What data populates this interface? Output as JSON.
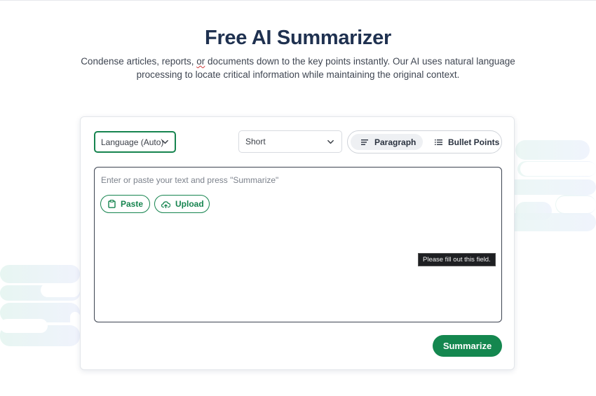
{
  "header": {
    "title": "Free AI Summarizer",
    "subtitle_part1": "Condense articles, reports, ",
    "subtitle_mark": "or",
    "subtitle_part2": " documents down to the key points instantly. Our AI uses natural language processing to locate critical information while maintaining the original context."
  },
  "toolbar": {
    "language_label": "Language (Auto)",
    "length_value": "Short",
    "modes": [
      {
        "label": "Paragraph",
        "icon": "paragraph-lines-icon",
        "selected": true
      },
      {
        "label": "Bullet Points",
        "icon": "bullet-list-icon",
        "selected": false
      }
    ]
  },
  "editor": {
    "placeholder": "Enter or paste your text and press \"Summarize\"",
    "paste_label": "Paste",
    "upload_label": "Upload",
    "tooltip": "Please fill out this field."
  },
  "actions": {
    "summarize_label": "Summarize"
  },
  "colors": {
    "brand_green": "#14874f",
    "title_navy": "#1f3150"
  }
}
